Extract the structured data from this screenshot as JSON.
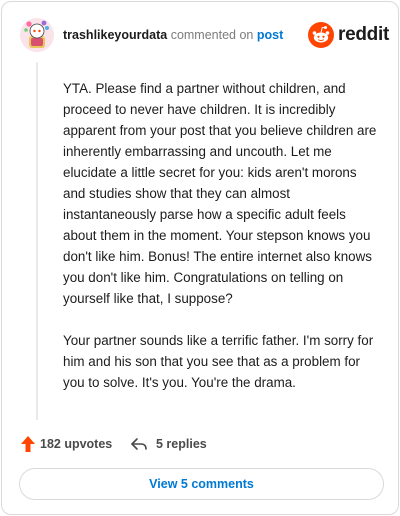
{
  "header": {
    "username": "trashlikeyourdata",
    "action_text": " commented on ",
    "post_link": "post",
    "brand_word": "reddit",
    "avatar_icon": "snoo-avatar-icon",
    "logo_icon": "reddit-alien-icon"
  },
  "comment": {
    "paragraphs": [
      "YTA. Please find a partner without children, and proceed to never have children. It is incredibly apparent from your post that you believe children are inherently embarrassing and uncouth. Let me elucidate a little secret for you: kids aren't morons and studies show that they can almost instantaneously parse how a specific adult feels about them in the moment. Your stepson knows you don't like him. Bonus! The entire internet also knows you don't like him. Congratulations on telling on yourself like that, I suppose?",
      "Your partner sounds like a terrific father. I'm sorry for him and his son that you see that as a problem for you to solve. It's you. You're the drama."
    ]
  },
  "actions": {
    "upvotes_label": "182 upvotes",
    "replies_label": "5 replies",
    "upvote_icon": "upvote-arrow-icon",
    "reply_icon": "reply-arrow-icon"
  },
  "footer": {
    "view_comments_label": "View 5 comments"
  },
  "colors": {
    "brand_orange": "#ff4500",
    "link_blue": "#0079d3",
    "upvote_orange": "#ff4500",
    "text_gray": "#7c7c7c"
  }
}
